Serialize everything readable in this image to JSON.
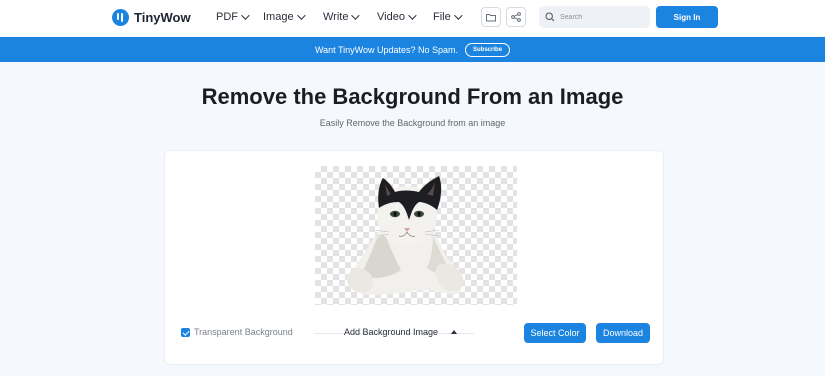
{
  "header": {
    "brand": "TinyWow",
    "nav": [
      {
        "label": "PDF"
      },
      {
        "label": "Image"
      },
      {
        "label": "Write"
      },
      {
        "label": "Video"
      },
      {
        "label": "File"
      }
    ],
    "search_placeholder": "Search",
    "signin_label": "Sign In"
  },
  "banner": {
    "text": "Want TinyWow Updates? No Spam.",
    "subscribe_label": "Subscribe"
  },
  "hero": {
    "title": "Remove the Background From an Image",
    "subtitle": "Easily Remove the Background from an image"
  },
  "editor": {
    "transparent_label": "Transparent Background",
    "transparent_checked": true,
    "add_bg_label": "Add Background Image",
    "select_color_label": "Select Color",
    "download_label": "Download"
  },
  "colors": {
    "accent": "#1b84e0"
  },
  "icons": [
    "logo-icon",
    "folder-icon",
    "share-icon",
    "search-icon",
    "caret-up-icon",
    "check-icon"
  ]
}
